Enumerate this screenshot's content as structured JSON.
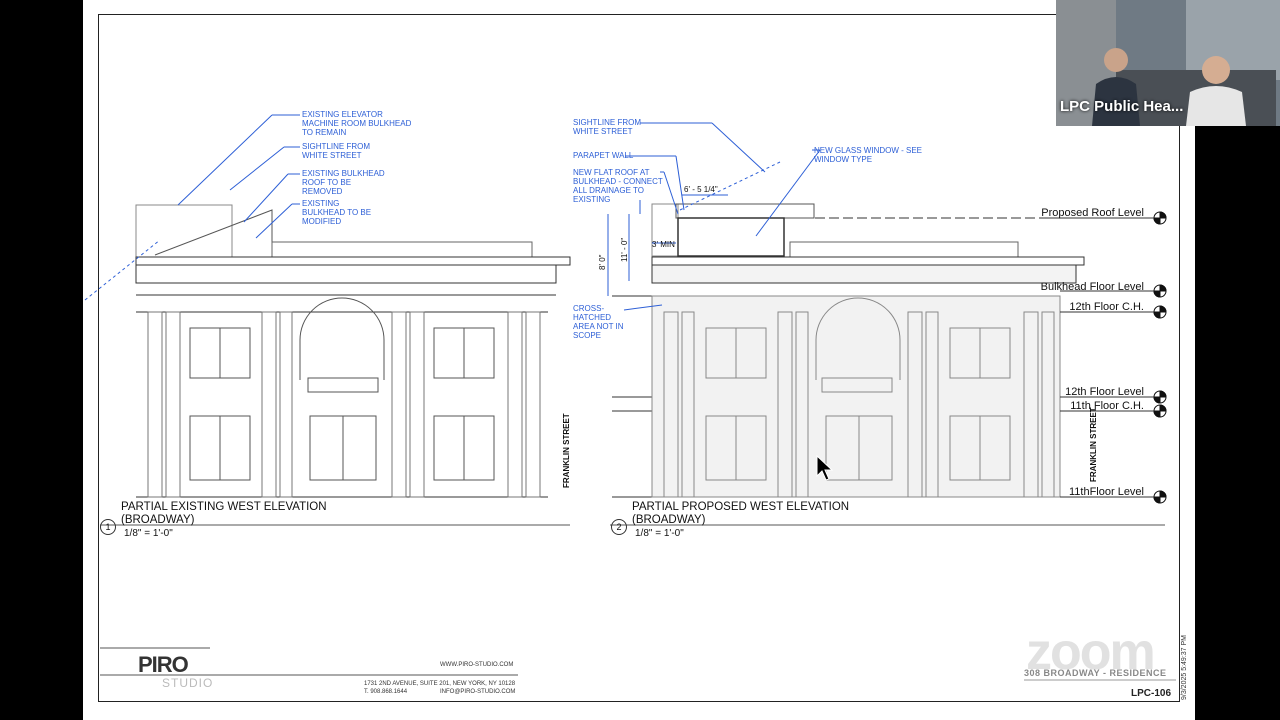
{
  "drawing": {
    "elevation_left": {
      "title_line1": "PARTIAL EXISTING WEST ELEVATION",
      "title_line2": "(BROADWAY)",
      "scale": "1/8\" = 1'-0\"",
      "number": "1",
      "street_label": "FRANKLIN STREET",
      "notes": [
        "EXISTING ELEVATOR MACHINE ROOM BULKHEAD TO REMAIN",
        "SIGHTLINE FROM WHITE STREET",
        "EXISTING BULKHEAD ROOF TO BE REMOVED",
        "EXISTING BULKHEAD TO BE MODIFIED"
      ]
    },
    "elevation_right": {
      "title_line1": "PARTIAL PROPOSED WEST ELEVATION",
      "title_line2": "(BROADWAY)",
      "scale": "1/8\" = 1'-0\"",
      "number": "2",
      "street_label": "FRANKLIN STREET",
      "notes": [
        "SIGHTLINE FROM WHITE STREET",
        "PARAPET WALL",
        "NEW FLAT ROOF AT BULKHEAD - CONNECT ALL DRAINAGE TO EXISTING",
        "NEW GLASS WINDOW - SEE WINDOW TYPE",
        "CROSS-HATCHED AREA NOT IN SCOPE"
      ],
      "dimensions": [
        "6' - 5 1/4\"",
        "3' MIN",
        "11' - 0\"",
        "8' 0\""
      ]
    },
    "levels": [
      "Proposed Roof Level",
      "Bulkhead Floor Level",
      "12th Floor C.H.",
      "12th Floor Level",
      "11th Floor C.H.",
      "11thFloor Level"
    ],
    "titleblock": {
      "logo": "PIRO",
      "logo_sub": "STUDIO",
      "website": "WWW.PIRO-STUDIO.COM",
      "address": "1731 2ND AVENUE, SUITE 201, NEW YORK, NY 10128",
      "phone": "T. 908.868.1644",
      "email": "INFO@PIRO-STUDIO.COM",
      "project": "308 BROADWAY - RESIDENCE",
      "sheet": "LPC-106",
      "datestamp": "9/3/2025 5:49:37 PM"
    }
  },
  "meeting": {
    "participant_name": "LPC Public Hea...",
    "watermark": "zoom"
  }
}
